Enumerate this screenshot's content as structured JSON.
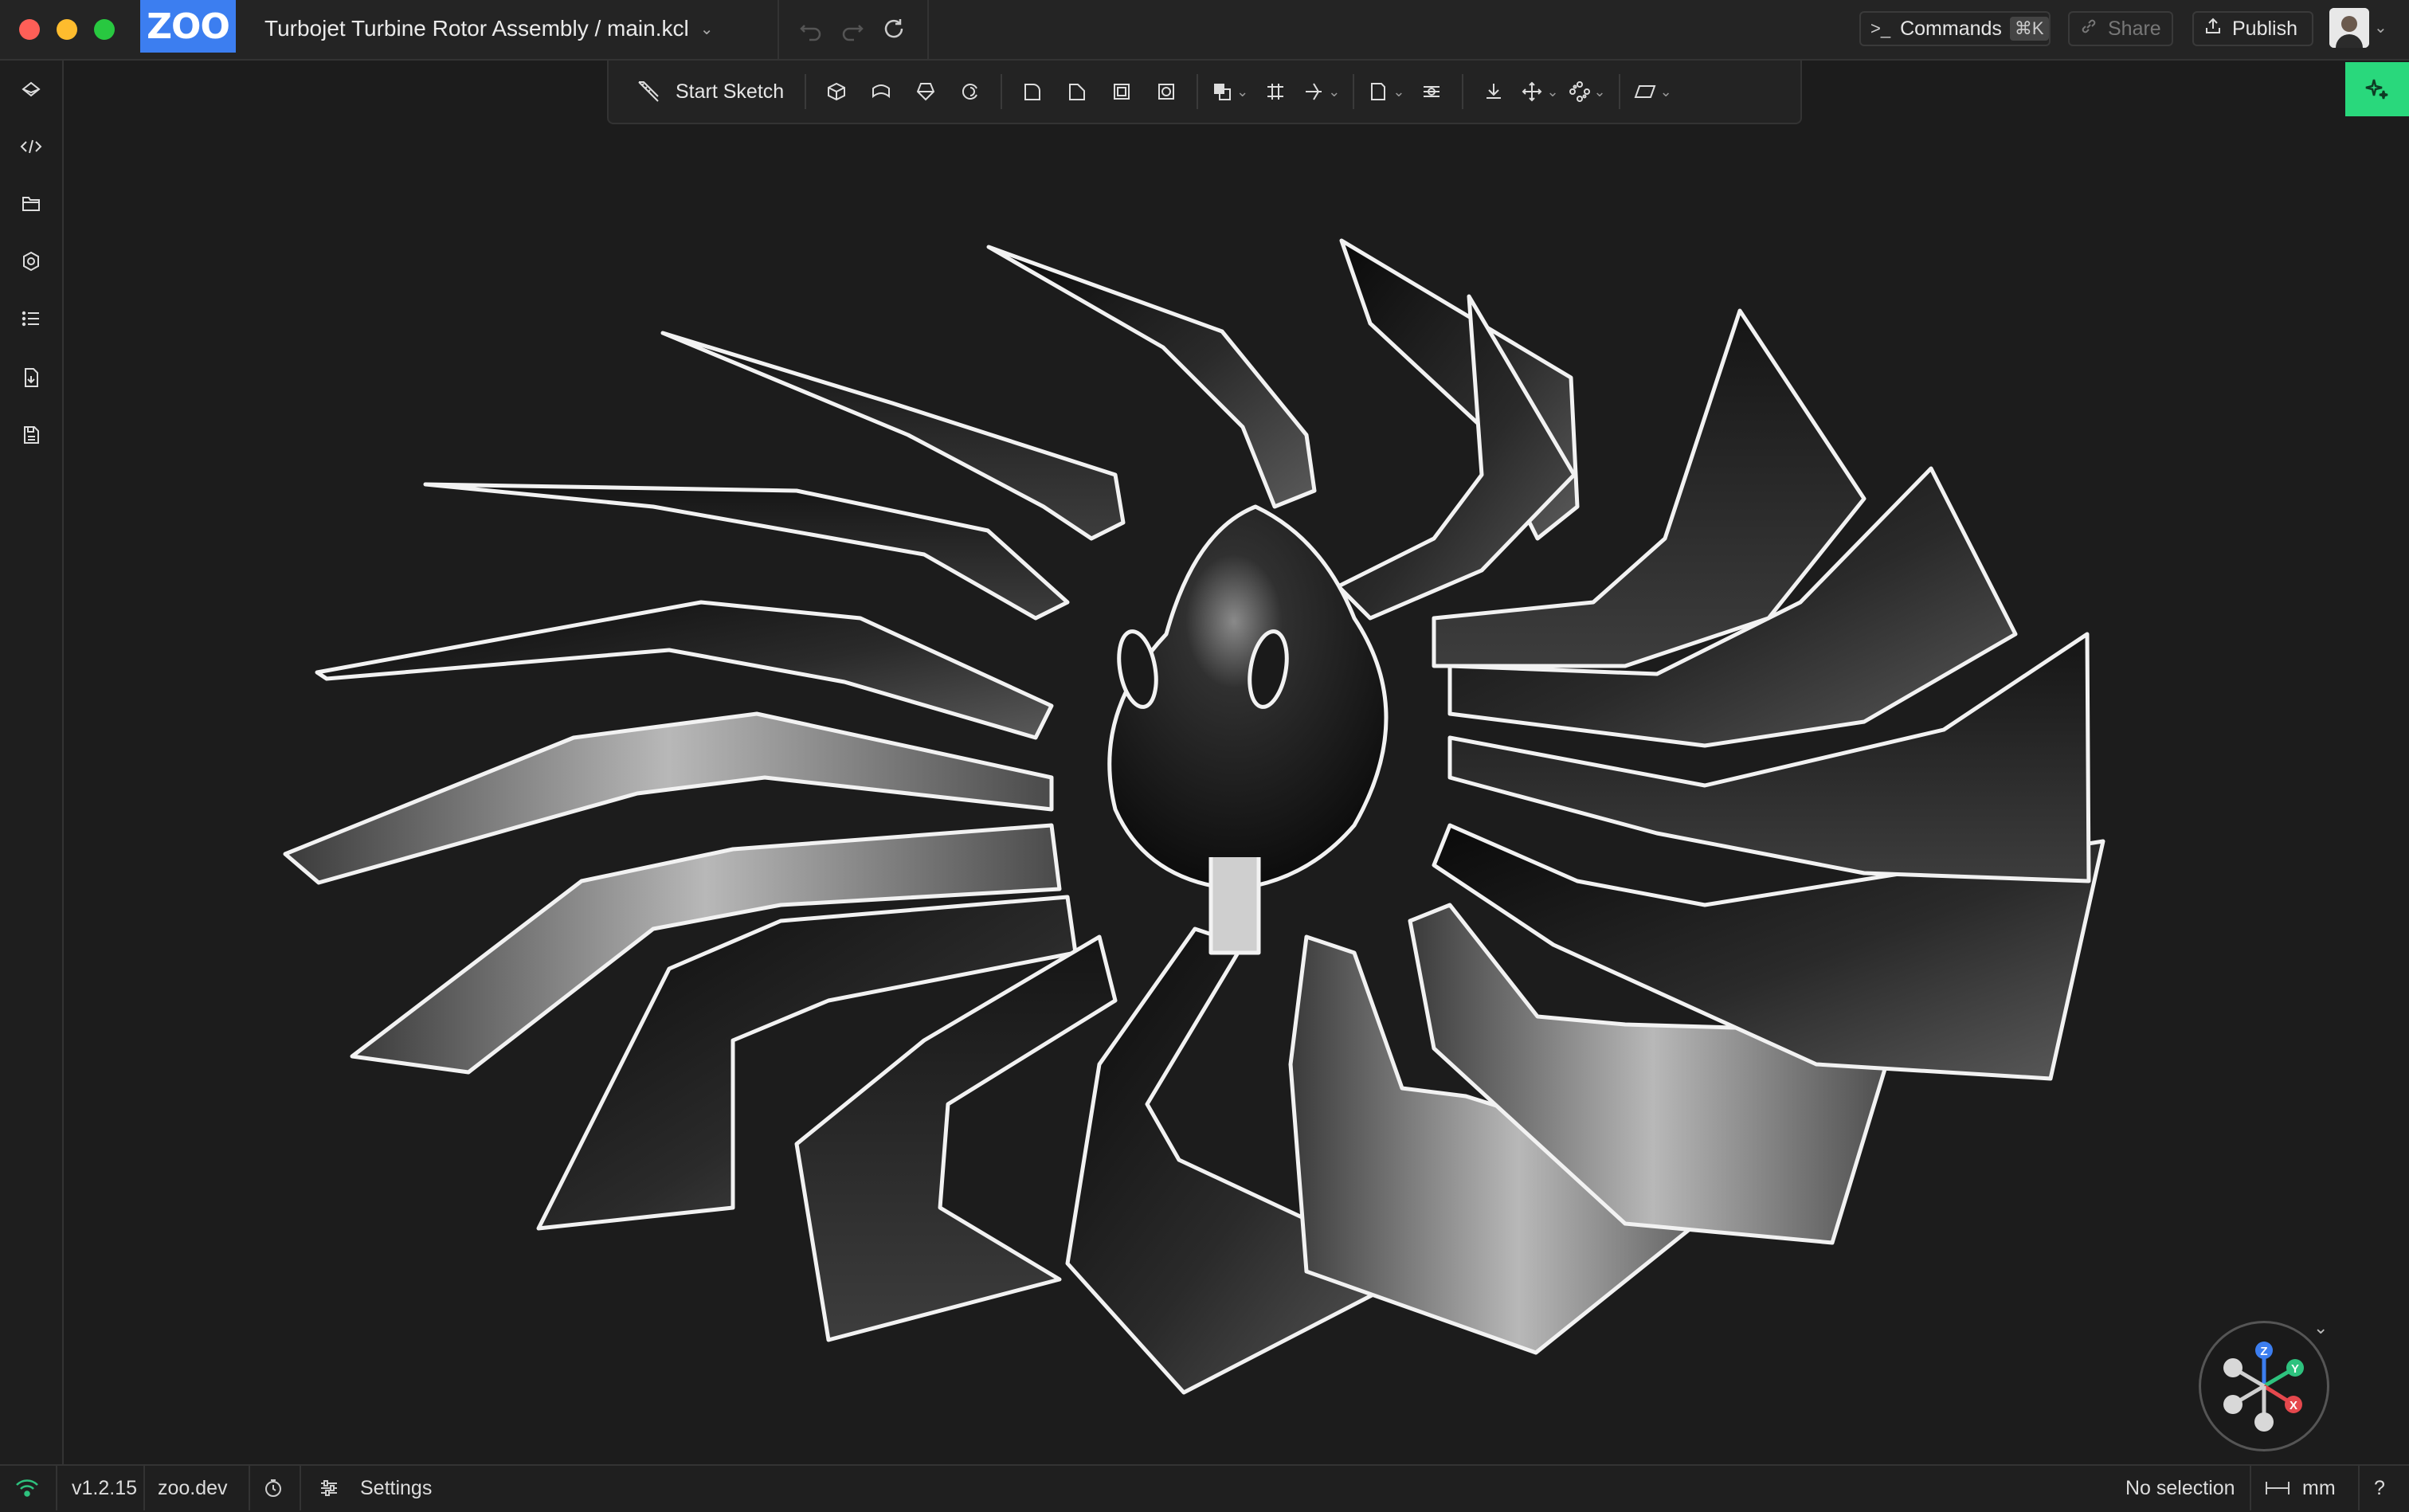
{
  "app": {
    "logo_text": "ZOO",
    "document_title": "Turbojet Turbine Rotor Assembly / main.kcl",
    "accent_color": "#3c7ef0",
    "panel_accent_color": "#29d87c"
  },
  "header": {
    "commands_label": "Commands",
    "commands_shortcut": "⌘K",
    "share_label": "Share",
    "publish_label": "Publish",
    "undo_icon": "undo-icon",
    "redo_icon": "redo-icon",
    "refresh_icon": "refresh-icon"
  },
  "sidebar": {
    "items": [
      {
        "name": "feature-tree-icon"
      },
      {
        "name": "code-icon"
      },
      {
        "name": "files-icon"
      },
      {
        "name": "settings-badge-icon"
      },
      {
        "name": "list-icon"
      },
      {
        "name": "export-icon"
      },
      {
        "name": "save-file-icon"
      }
    ]
  },
  "toolbar": {
    "start_sketch_label": "Start Sketch",
    "tools": [
      "extrude-icon",
      "sweep-icon",
      "loft-icon",
      "revolve-icon",
      "fillet-icon",
      "chamfer-icon",
      "shell-icon",
      "hole-icon",
      "boolean-icon",
      "offset-plane-icon",
      "helix-icon",
      "plane-icon",
      "insert-icon",
      "import-icon",
      "translate-icon",
      "pattern-icon",
      "view-icon"
    ]
  },
  "viewport": {
    "scene": "turbine-rotor-model"
  },
  "status": {
    "version": "v1.2.15",
    "site": "zoo.dev",
    "settings_label": "Settings",
    "selection": "No selection",
    "units": "mm",
    "help": "?"
  },
  "axes": {
    "z_label": "Z",
    "y_label": "Y",
    "x_label": "X",
    "z_color": "#3c7ef0",
    "y_color": "#2ec27e",
    "x_color": "#e5484d"
  }
}
